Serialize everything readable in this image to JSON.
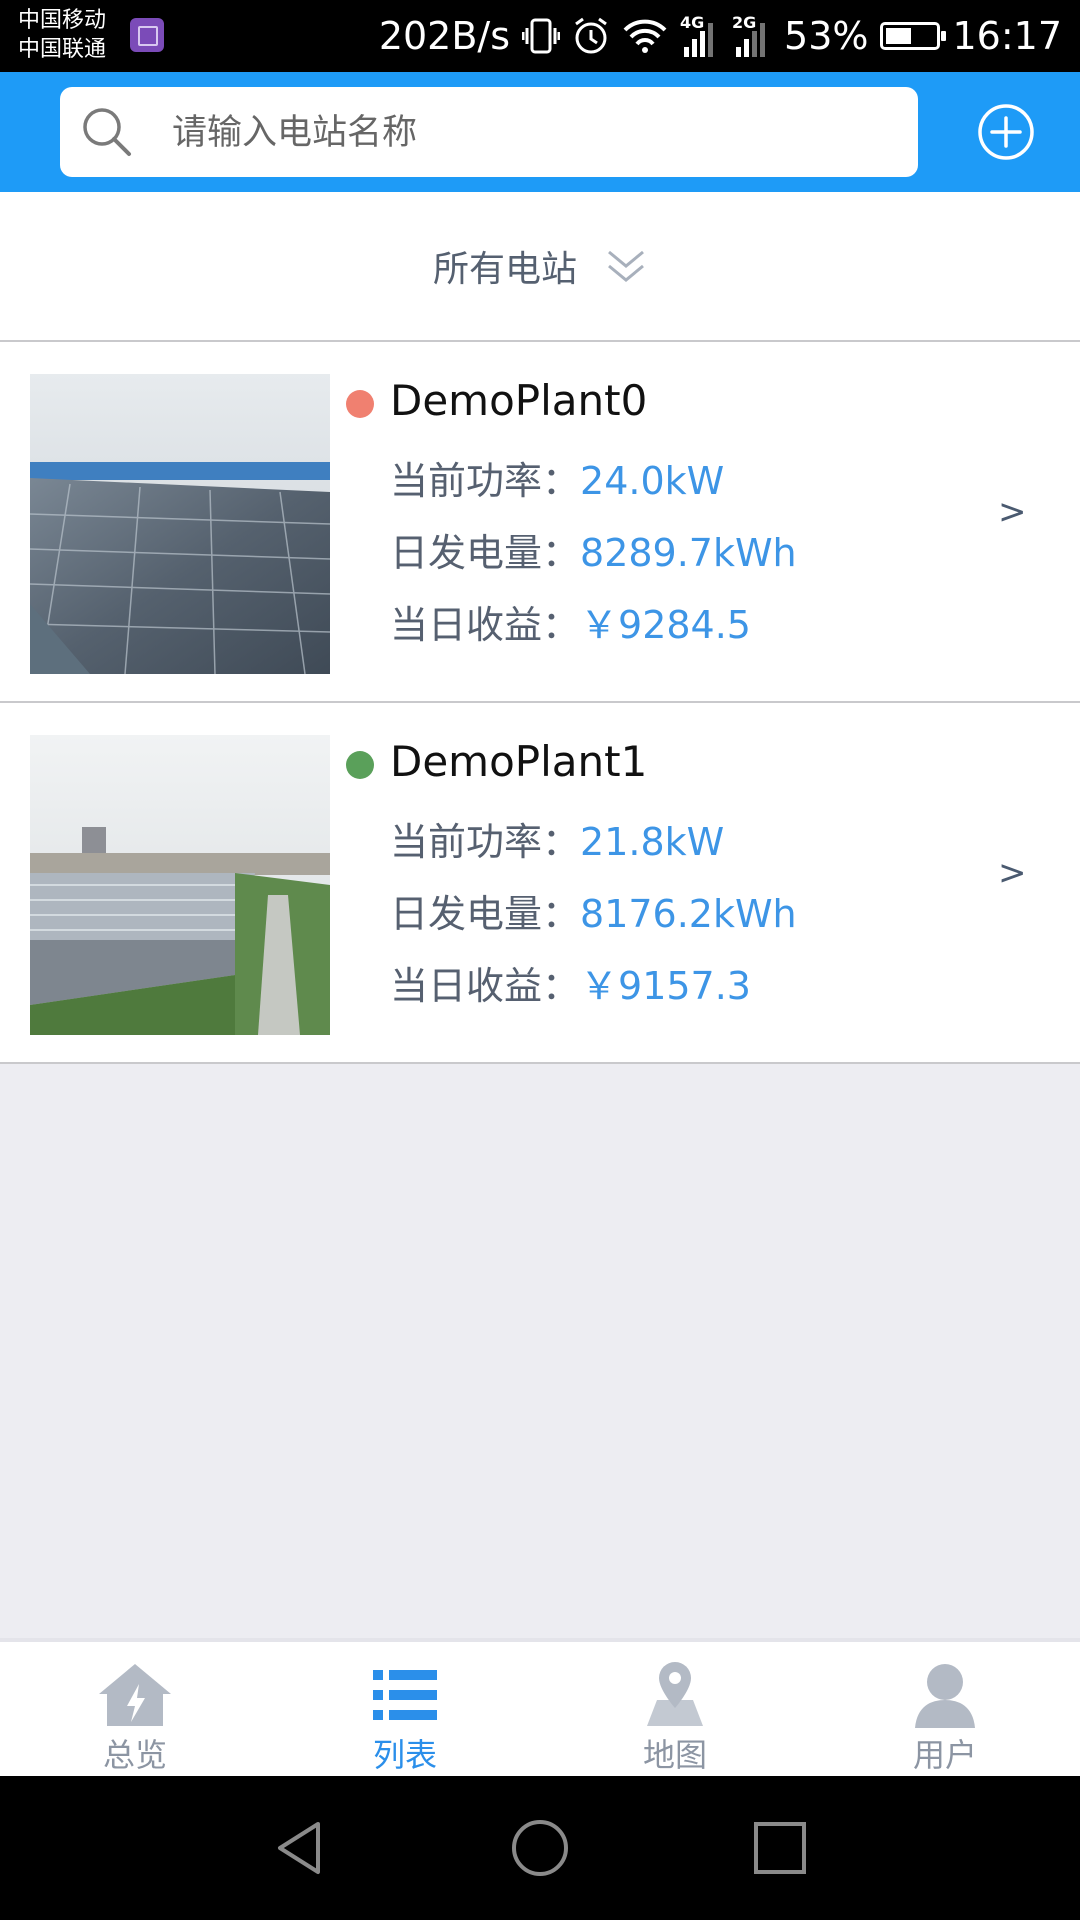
{
  "status_bar": {
    "carrier_1": "中国移动",
    "carrier_2": "中国联通",
    "net_speed": "202B/s",
    "net_type_1": "4G",
    "net_type_2": "2G",
    "battery": "53%",
    "battery_level": 0.53,
    "time": "16:17",
    "icons": [
      "gallery-icon",
      "vibrate-icon",
      "alarm-icon",
      "wifi-icon",
      "signal-icon",
      "battery-icon"
    ]
  },
  "header": {
    "search_placeholder": "请输入电站名称",
    "search_value": "",
    "accent_color": "#1e9bf7",
    "icons": [
      "search-icon",
      "add-circle-icon"
    ]
  },
  "filter": {
    "label": "所有电站",
    "icon": "double-chevron-down-icon"
  },
  "plants": [
    {
      "name": "DemoPlant0",
      "status_color": "#f08070",
      "power_label": "当前功率：",
      "power_value": "24.0kW",
      "energy_label": "日发电量：",
      "energy_value": "8289.7kWh",
      "income_label": "当日收益：",
      "income_value": "￥9284.5",
      "arrow": ">"
    },
    {
      "name": "DemoPlant1",
      "status_color": "#5aa05a",
      "power_label": "当前功率：",
      "power_value": "21.8kW",
      "energy_label": "日发电量：",
      "energy_value": "8176.2kWh",
      "income_label": "当日收益：",
      "income_value": "￥9157.3",
      "arrow": ">"
    }
  ],
  "bottom_nav": {
    "items": [
      {
        "label": "总览",
        "icon": "home-icon",
        "active": false
      },
      {
        "label": "列表",
        "icon": "list-icon",
        "active": true
      },
      {
        "label": "地图",
        "icon": "map-pin-icon",
        "active": false
      },
      {
        "label": "用户",
        "icon": "user-icon",
        "active": false
      }
    ],
    "active_color": "#2b8fea",
    "inactive_color": "#8c95a3"
  },
  "system_nav": {
    "icons": [
      "back-icon",
      "home-circle-icon",
      "recents-icon"
    ]
  }
}
